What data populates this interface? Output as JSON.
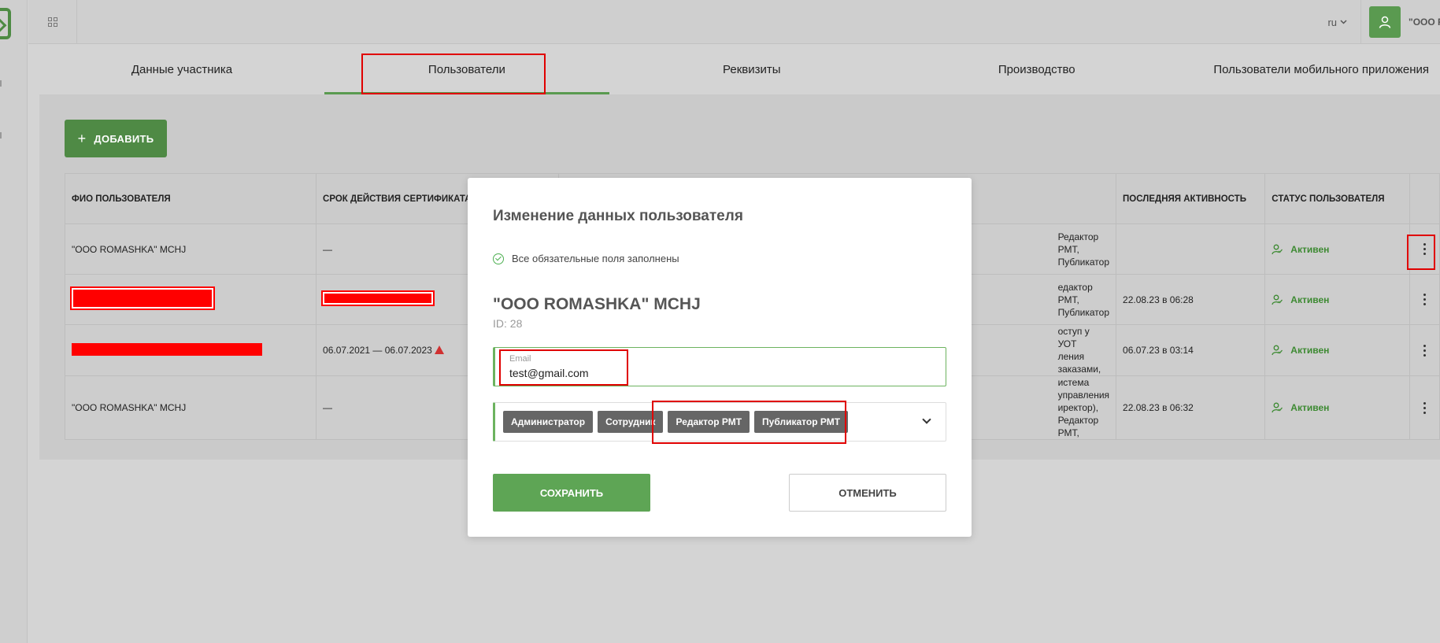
{
  "header": {
    "lang": "ru",
    "user_name": "\"ООО R. M"
  },
  "tabs": [
    {
      "label": "Данные участника"
    },
    {
      "label": "Пользователи"
    },
    {
      "label": "Реквизиты"
    },
    {
      "label": "Производство"
    },
    {
      "label": "Пользователи мобильного приложения"
    }
  ],
  "toolbar": {
    "add_label": "ДОБАВИТЬ"
  },
  "table": {
    "columns": [
      "ФИО ПОЛЬЗОВАТЕЛЯ",
      "СРОК ДЕЙСТВИЯ СЕРТИФИКАТА",
      "",
      "ПОСЛЕДНЯЯ АКТИВНОСТЬ",
      "СТАТУС ПОЛЬЗОВАТЕЛЯ",
      ""
    ],
    "rows": [
      {
        "name": "\"OOO ROMASHKA\" MCHJ",
        "cert": "—",
        "roles": "Редактор РМТ, Публикатор",
        "roles2": "",
        "activity": "",
        "status": "Активен"
      },
      {
        "name": "",
        "cert": "",
        "roles": "едактор РМТ, Публикатор",
        "roles2": "",
        "activity": "22.08.23 в 06:28",
        "status": "Активен"
      },
      {
        "name": "",
        "cert": "06.07.2021 — 06.07.2023",
        "roles": "оступ у УОТ",
        "roles2": "ления заказами,",
        "activity": "06.07.23 в 03:14",
        "status": "Активен"
      },
      {
        "name": "\"OOO ROMASHKA\" MCHJ",
        "cert": "—",
        "roles": "истема управления",
        "roles2": "иректор), Редактор РМТ,",
        "activity": "22.08.23 в 06:32",
        "status": "Активен"
      }
    ]
  },
  "modal": {
    "title": "Изменение данных пользователя",
    "validation": "Все обязательные поля заполнены",
    "org_name": "\"OOO ROMASHKA\" MCHJ",
    "org_id": "ID: 28",
    "email_label": "Email",
    "email_value": "test@gmail.com",
    "roles": [
      "Администратор",
      "Сотрудник",
      "Редактор РМТ",
      "Публикатор РМТ"
    ],
    "save_label": "СОХРАНИТЬ",
    "cancel_label": "ОТМЕНИТЬ"
  },
  "colors": {
    "accent": "#5a9a50",
    "highlight": "#e00000",
    "status": "#3d8a32"
  }
}
